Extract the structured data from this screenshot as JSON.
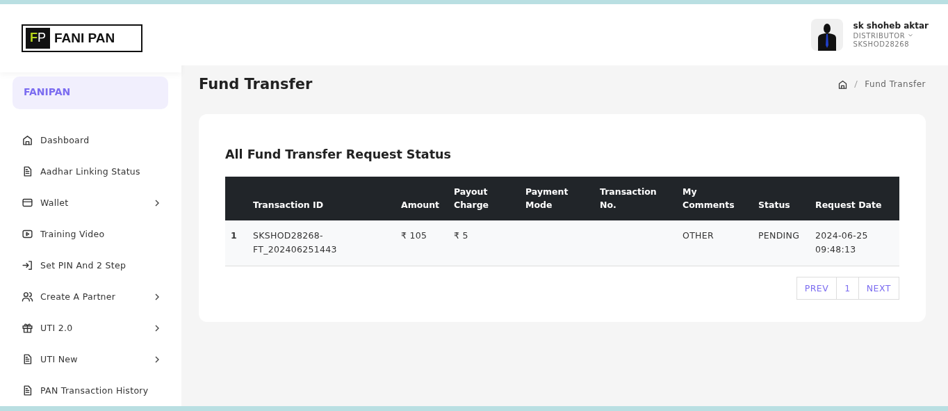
{
  "logo": {
    "mark": [
      "F",
      "P"
    ],
    "name": "FANI PAN"
  },
  "sidebar": {
    "brand": "FANIPAN",
    "items": [
      {
        "label": "Dashboard",
        "kind": "home",
        "has_submenu": false
      },
      {
        "label": "Aadhar Linking Status",
        "kind": "doc",
        "has_submenu": false
      },
      {
        "label": "Wallet",
        "kind": "card",
        "has_submenu": true
      },
      {
        "label": "Training Video",
        "kind": "video",
        "has_submenu": false
      },
      {
        "label": "Set PIN And 2 Step",
        "kind": "login",
        "has_submenu": false
      },
      {
        "label": "Create A Partner",
        "kind": "users",
        "has_submenu": true
      },
      {
        "label": "UTI 2.0",
        "kind": "gift",
        "has_submenu": true
      },
      {
        "label": "UTI New",
        "kind": "doc",
        "has_submenu": true
      },
      {
        "label": "PAN Transaction History",
        "kind": "doc",
        "has_submenu": false
      }
    ]
  },
  "user": {
    "name": "sk shoheb aktar",
    "role": "DISTRIBUTOR",
    "id": "SKSHOD28268"
  },
  "page_title": "Fund Transfer",
  "breadcrumb": [
    "Fund Transfer"
  ],
  "card_title": "All Fund Transfer Request Status",
  "table": {
    "columns": [
      "",
      "Transaction ID",
      "Amount",
      "Payout Charge",
      "Payment Mode",
      "Transaction No.",
      "My Comments",
      "Status",
      "Request Date"
    ],
    "rows": [
      [
        "1",
        "SKSHOD28268-FT_202406251443",
        "₹ 105",
        "₹ 5",
        "",
        "",
        "OTHER",
        "PENDING",
        "2024-06-25 09:48:13"
      ]
    ]
  },
  "pagination": [
    "PREV",
    "1",
    "NEXT"
  ]
}
